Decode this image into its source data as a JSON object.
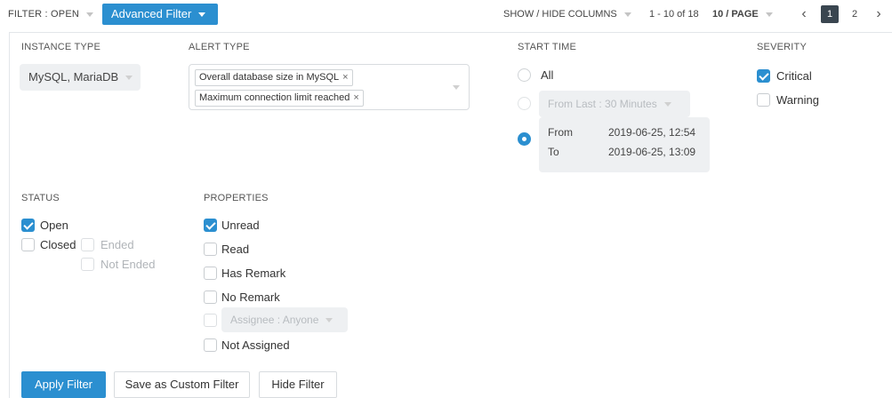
{
  "topbar": {
    "filter_open_label": "FILTER : OPEN",
    "advanced_filter_label": "Advanced Filter",
    "show_hide_columns_label": "SHOW / HIDE COLUMNS",
    "range_info": "1 - 10 of 18",
    "per_page_label": "10 / PAGE",
    "pager": {
      "prev": "‹",
      "pages": [
        "1",
        "2"
      ],
      "active_page": "1",
      "next": "›"
    }
  },
  "instance_type": {
    "label": "INSTANCE TYPE",
    "value": "MySQL, MariaDB"
  },
  "alert_type": {
    "label": "ALERT TYPE",
    "tags": [
      "Overall database size in MySQL",
      "Maximum connection limit reached"
    ],
    "remove_symbol": "×"
  },
  "start_time": {
    "label": "START TIME",
    "options": {
      "all": "All",
      "from_last": "From Last : 30 Minutes",
      "range": {
        "from_label": "From",
        "from_value": "2019-06-25, 12:54",
        "to_label": "To",
        "to_value": "2019-06-25, 13:09"
      }
    },
    "selected": "range"
  },
  "severity": {
    "label": "SEVERITY",
    "options": [
      {
        "label": "Critical",
        "checked": true
      },
      {
        "label": "Warning",
        "checked": false
      }
    ]
  },
  "status": {
    "label": "STATUS",
    "open": {
      "label": "Open",
      "checked": true
    },
    "closed": {
      "label": "Closed",
      "checked": false
    },
    "ended": {
      "label": "Ended",
      "checked": false,
      "disabled": true
    },
    "not_ended": {
      "label": "Not Ended",
      "checked": false,
      "disabled": true
    }
  },
  "properties": {
    "label": "PROPERTIES",
    "unread": {
      "label": "Unread",
      "checked": true
    },
    "read": {
      "label": "Read",
      "checked": false
    },
    "has_remark": {
      "label": "Has Remark",
      "checked": false
    },
    "no_remark": {
      "label": "No Remark",
      "checked": false
    },
    "assignee": {
      "label": "Assignee : Anyone",
      "checked": false,
      "disabled": true
    },
    "not_assigned": {
      "label": "Not Assigned",
      "checked": false
    }
  },
  "actions": {
    "apply": "Apply Filter",
    "save_custom": "Save as Custom Filter",
    "hide": "Hide Filter"
  },
  "colors": {
    "accent": "#2b8fd0",
    "pager_active": "#3a4650"
  }
}
